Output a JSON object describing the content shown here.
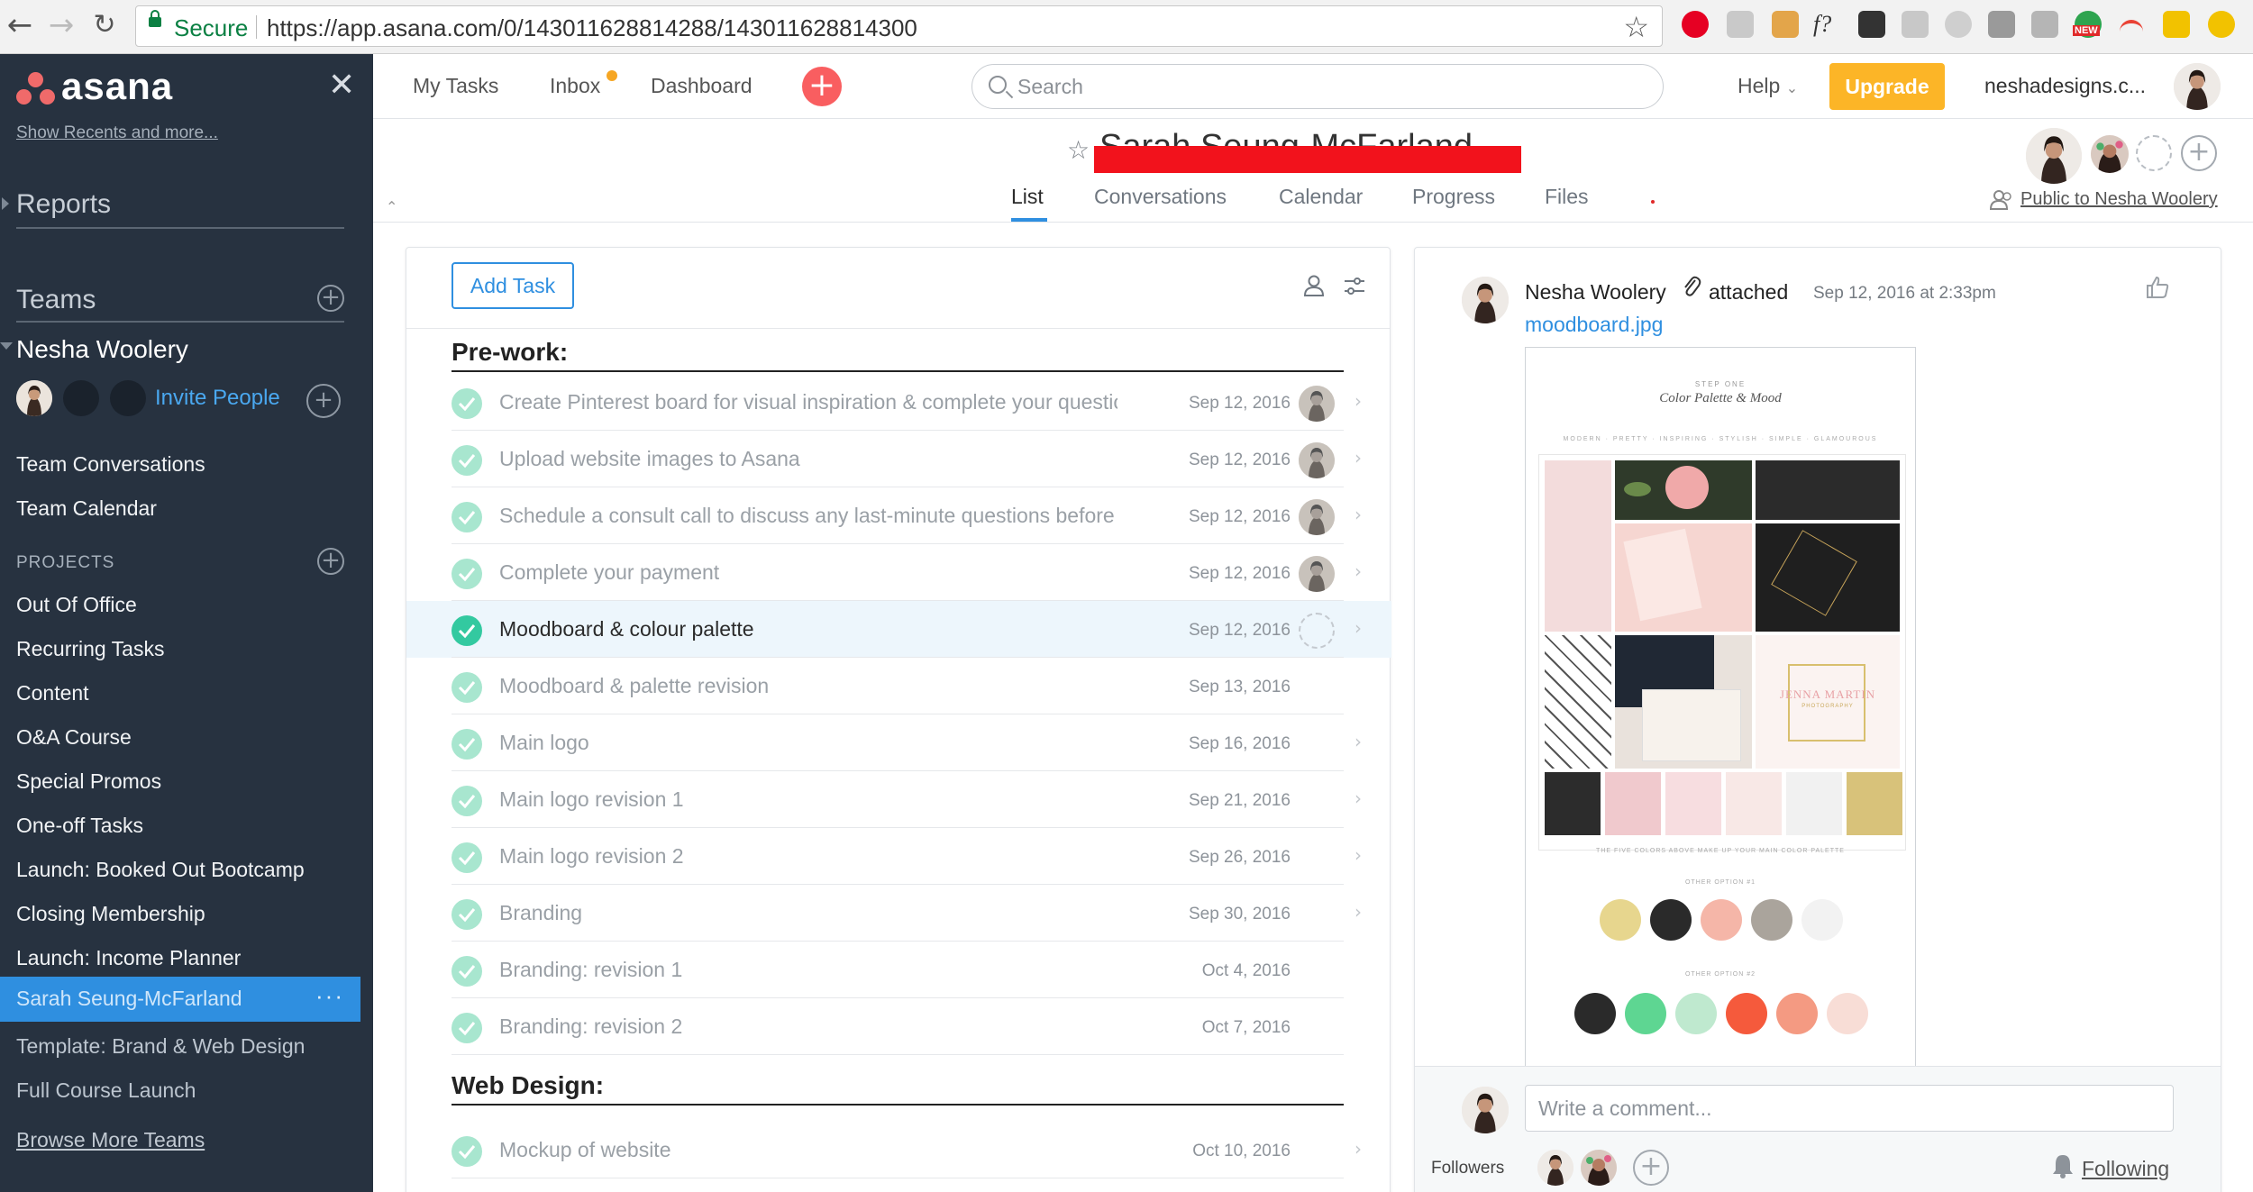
{
  "browser": {
    "secure_label": "Secure",
    "url": "https://app.asana.com/0/143011628814288/143011628814300",
    "new_badge": "NEW"
  },
  "sidebar": {
    "logo_text": "asana",
    "recents_link": "Show Recents and more...",
    "reports": "Reports",
    "teams": "Teams",
    "team_name": "Nesha Woolery",
    "invite": "Invite People",
    "team_links": [
      "Team Conversations",
      "Team Calendar"
    ],
    "projects_label": "PROJECTS",
    "projects": [
      "Out Of Office",
      "Recurring Tasks",
      "Content",
      "O&A Course",
      "Special Promos",
      "One-off Tasks",
      "Launch: Booked Out Bootcamp",
      "Closing Membership",
      "Launch: Income Planner",
      "Sarah Seung-McFarland",
      "Template: Brand & Web Design",
      "Full Course Launch"
    ],
    "active_project_index": 9,
    "more_dots": "···",
    "browse": "Browse More Teams"
  },
  "topbar": {
    "my_tasks": "My Tasks",
    "inbox": "Inbox",
    "dashboard": "Dashboard",
    "search_placeholder": "Search",
    "help": "Help",
    "upgrade": "Upgrade",
    "account": "neshadesigns.c..."
  },
  "project": {
    "title": "Sarah Seung-McFarland",
    "tabs": [
      "List",
      "Conversations",
      "Calendar",
      "Progress",
      "Files"
    ],
    "active_tab": "List",
    "privacy": "Public to Nesha Woolery"
  },
  "list": {
    "add_task": "Add Task",
    "sections": [
      {
        "title": "Pre-work:",
        "tasks": [
          {
            "name": "Create Pinterest board for visual inspiration & complete your questionnaire",
            "date": "Sep 12, 2016",
            "assignee": "avatar"
          },
          {
            "name": "Upload website images to Asana",
            "date": "Sep 12, 2016",
            "assignee": "avatar"
          },
          {
            "name": "Schedule a consult call to discuss any last-minute questions before the project",
            "date": "Sep 12, 2016",
            "assignee": "avatar"
          },
          {
            "name": "Complete your payment",
            "date": "Sep 12, 2016",
            "assignee": "avatar"
          },
          {
            "name": "Moodboard & colour palette",
            "date": "Sep 12, 2016",
            "assignee": "ghost"
          },
          {
            "name": "Moodboard & palette revision",
            "date": "Sep 13, 2016",
            "assignee": "none"
          },
          {
            "name": "Main logo",
            "date": "Sep 16, 2016",
            "assignee": "none"
          },
          {
            "name": "Main logo revision 1",
            "date": "Sep 21, 2016",
            "assignee": "none"
          },
          {
            "name": "Main logo revision 2",
            "date": "Sep 26, 2016",
            "assignee": "none"
          },
          {
            "name": "Branding",
            "date": "Sep 30, 2016",
            "assignee": "none"
          },
          {
            "name": "Branding: revision 1",
            "date": "Oct 4, 2016",
            "assignee": "none"
          },
          {
            "name": "Branding: revision 2",
            "date": "Oct 7, 2016",
            "assignee": "none"
          }
        ]
      },
      {
        "title": "Web Design:",
        "tasks": [
          {
            "name": "Mockup of website",
            "date": "Oct 10, 2016",
            "assignee": "none"
          }
        ]
      }
    ]
  },
  "detail": {
    "author": "Nesha Woolery",
    "action": "attached",
    "time": "Sep 12, 2016 at 2:33pm",
    "file": "moodboard.jpg",
    "moodboard": {
      "step": "STEP ONE",
      "title": "Color Palette & Mood",
      "tags": "MODERN · PRETTY · INSPIRING · STYLISH · SIMPLE · GLAMOUROUS",
      "caption": "THE FIVE COLORS ABOVE MAKE UP YOUR MAIN COLOR PALETTE",
      "option1": "OTHER OPTION #1",
      "option2": "OTHER OPTION #2",
      "sample_name": "JENNA MARTIN",
      "sample_sub": "PHOTOGRAPHY",
      "palette_main": [
        "#2c2c2c",
        "#f0c9cd",
        "#f7dde0",
        "#f8e8e6",
        "#f1f1f1",
        "#d8c27a"
      ],
      "palette_opt1": [
        "#e7d68e",
        "#2a2a2a",
        "#f5b6a8",
        "#aaa49c",
        "#f2f2f2"
      ],
      "palette_opt2": [
        "#2a2a2a",
        "#5ed692",
        "#bfe9cf",
        "#f55a3c",
        "#f49a82",
        "#f8ddd6"
      ]
    },
    "comment_placeholder": "Write a comment...",
    "followers_label": "Followers",
    "following": "Following"
  },
  "colors": {
    "sidebar_bg": "#273240",
    "accent_blue": "#2f8fe0",
    "upgrade": "#fcb527",
    "quick_add": "#f95e60",
    "check_done": "#33c9a0",
    "check_light": "#a8e6cf"
  }
}
